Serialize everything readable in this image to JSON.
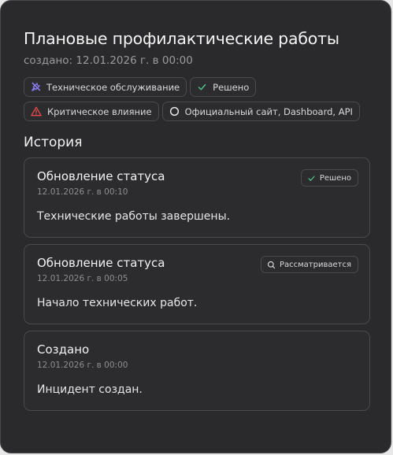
{
  "header": {
    "title": "Плановые профилактические работы",
    "created": "создано: 12.01.2026 г. в 00:00"
  },
  "tags": [
    {
      "label": "Техническое обслуживание",
      "icon": "wrench-screwdriver-icon",
      "color": "#8a7cf0"
    },
    {
      "label": "Решено",
      "icon": "check-icon",
      "color": "#4cc38a"
    },
    {
      "label": "Критическое влияние",
      "icon": "warning-triangle-icon",
      "color": "#e5484d"
    },
    {
      "label": "Официальный сайт, Dashboard, API",
      "icon": "circle-icon",
      "color": "#e6e6e8"
    }
  ],
  "history": {
    "title": "История",
    "items": [
      {
        "title": "Обновление статуса",
        "time": "12.01.2026 г. в 00:10",
        "body": "Технические работы завершены.",
        "badge": "Решено",
        "badge_icon": "check-icon"
      },
      {
        "title": "Обновление статуса",
        "time": "12.01.2026 г. в 00:05",
        "body": "Начало технических работ.",
        "badge": "Рассматривается",
        "badge_icon": "search-icon"
      },
      {
        "title": "Создано",
        "time": "12.01.2026 г. в 00:00",
        "body": "Инцидент создан."
      }
    ]
  },
  "colors": {
    "background": "#2a2a2c",
    "border": "#4a4a4d",
    "success": "#4cc38a",
    "danger": "#e5484d",
    "maintenance": "#8a7cf0"
  }
}
